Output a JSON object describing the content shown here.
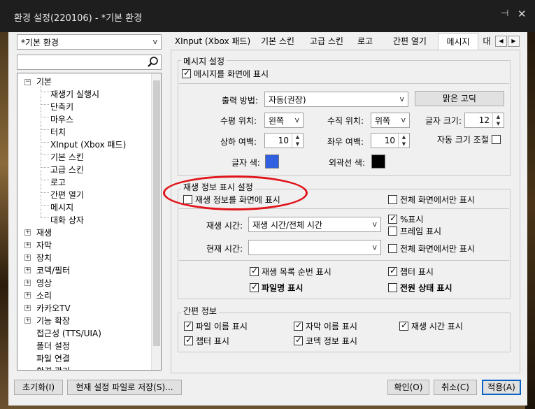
{
  "window": {
    "title": "환경 설정(220106) - *기본 환경"
  },
  "preset": {
    "value": "*기본 환경"
  },
  "search": {
    "value": ""
  },
  "tree": {
    "root_label": "기본",
    "children": [
      "재생기 실행시",
      "단축키",
      "마우스",
      "터치",
      "XInput (Xbox 패드)",
      "기본 스킨",
      "고급 스킨",
      "로고",
      "간편 열기",
      "메시지",
      "대화 상자"
    ],
    "categories": [
      "재생",
      "자막",
      "장치",
      "코덱/필터",
      "영상",
      "소리",
      "카카오TV",
      "기능 확장",
      "접근성 (TTS/UIA)",
      "폴더 설정",
      "파일 연결",
      "환경 관리"
    ]
  },
  "tabs": [
    "XInput (Xbox 패드)",
    "기본 스킨",
    "고급 스킨",
    "로고",
    "간편 열기",
    "메시지",
    "대"
  ],
  "message": {
    "group_title": "메시지 설정",
    "show_label": "메시지를 화면에 표시",
    "output_method_label": "출력 방법:",
    "output_method_value": "자동(권장)",
    "font_button": "맑은 고딕",
    "hpos_label": "수평 위치:",
    "hpos_value": "왼쪽",
    "vpos_label": "수직 위치:",
    "vpos_value": "위쪽",
    "size_label": "글자 크기:",
    "size_value": "12",
    "vmargin_label": "상하 여백:",
    "vmargin_value": "10",
    "hmargin_label": "좌우 여백:",
    "hmargin_value": "10",
    "autosize_label": "자동 크기 조절",
    "font_color_label": "글자 색:",
    "font_color": "#3060e0",
    "outline_color_label": "외곽선 색:",
    "outline_color": "#000000"
  },
  "playback": {
    "group_title": "재생 정보 표시 설정",
    "show_label": "재생 정보를 화면에 표시",
    "fullscreen_only_label": "전체 화면에서만 표시",
    "play_time_label": "재생 시간:",
    "play_time_value": "재생 시간/전체 시간",
    "percent_label": "%표시",
    "frame_label": "프레임 표시",
    "current_time_label": "현재 시간:",
    "current_time_value": "",
    "fullscreen_only2_label": "전체 화면에서만 표시",
    "playlist_order_label": "재생 목록 순번 표시",
    "chapter_label": "챕터 표시",
    "filename_label": "파일명 표시",
    "power_label": "전원 상태 표시"
  },
  "brief": {
    "group_title": "간편 정보",
    "filename_label": "파일 이름 표시",
    "subtitle_label": "자막 이름 표시",
    "playtime_label": "재생 시간 표시",
    "chapter_label": "챕터 표시",
    "codec_label": "코덱 정보 표시"
  },
  "footer": {
    "reset": "초기화(I)",
    "save_current": "현재 설정 파일로 저장(S)...",
    "ok": "확인(O)",
    "cancel": "취소(C)",
    "apply": "적용(A)"
  }
}
